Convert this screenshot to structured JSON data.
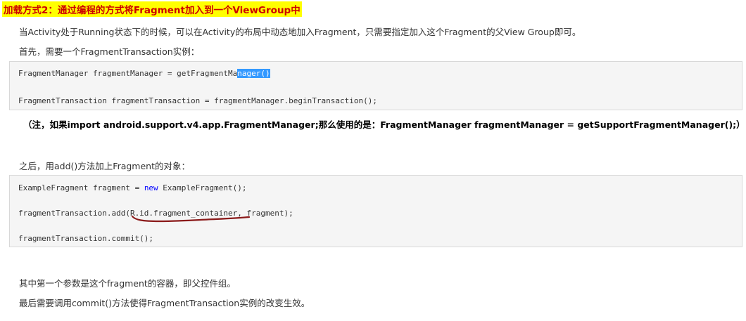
{
  "heading": "加载方式2：通过编程的方式将Fragment加入到一个ViewGroup中",
  "paragraphs": {
    "p1": "当Activity处于Running状态下的时候，可以在Activity的布局中动态地加入Fragment，只需要指定加入这个Fragment的父View Group即可。",
    "p2": "首先，需要一个FragmentTransaction实例：",
    "p3": "之后，用add()方法加上Fragment的对象：",
    "p4": "其中第一个参数是这个fragment的容器，即父控件组。",
    "p5": "最后需要调用commit()方法使得FragmentTransaction实例的改变生效。"
  },
  "code_block_1": {
    "line1_before_selection": "FragmentManager fragmentManager = getFragmentMa",
    "line1_selected": "nager()",
    "line2": "FragmentTransaction fragmentTransaction = fragmentManager.beginTransaction();"
  },
  "note": "（注，如果import android.support.v4.app.FragmentManager;那么使用的是：FragmentManager fragmentManager = getSupportFragmentManager();）",
  "code_block_2": {
    "line1_before_keyword": "ExampleFragment fragment = ",
    "line1_keyword": "new",
    "line1_after_keyword": " ExampleFragment();",
    "line2": "fragmentTransaction.add(R.id.fragment_container, fragment);",
    "line3": "fragmentTransaction.commit();"
  },
  "colors": {
    "heading_highlight": "#ffff00",
    "heading_text": "#cc0000",
    "selection": "#3399ff",
    "keyword": "#0000ff",
    "annotation_stroke": "#8b1a1a"
  }
}
